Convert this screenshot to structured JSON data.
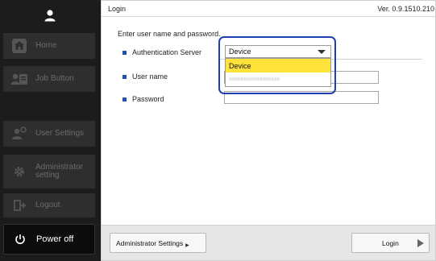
{
  "sidebar": {
    "items": [
      {
        "label": "Home",
        "icon": "home-icon"
      },
      {
        "label": "Job Button",
        "icon": "job-button-icon"
      },
      {
        "label": "User Settings",
        "icon": "user-settings-icon"
      },
      {
        "label": "Administrator setting",
        "icon": "gear-icon"
      },
      {
        "label": "Logout",
        "icon": "logout-icon"
      }
    ],
    "power": {
      "label": "Power off",
      "icon": "power-icon"
    }
  },
  "header": {
    "title": "Login",
    "version": "Ver. 0.9.1510.210"
  },
  "form": {
    "instruction": "Enter user name and password.",
    "auth_server_label": "Authentication Server",
    "auth_server_value": "Device",
    "auth_server_options": [
      "Device",
      "xxxxxxxxxxxxxxxxxx"
    ],
    "username_label": "User name",
    "username_value": "",
    "password_label": "Password",
    "password_value": ""
  },
  "footer": {
    "admin_settings_label": "Administrator Settings",
    "login_label": "Login"
  },
  "colors": {
    "accent": "#1e4fb3",
    "selected_option": "#ffe23a",
    "highlight_ring": "#1f3fb8"
  }
}
